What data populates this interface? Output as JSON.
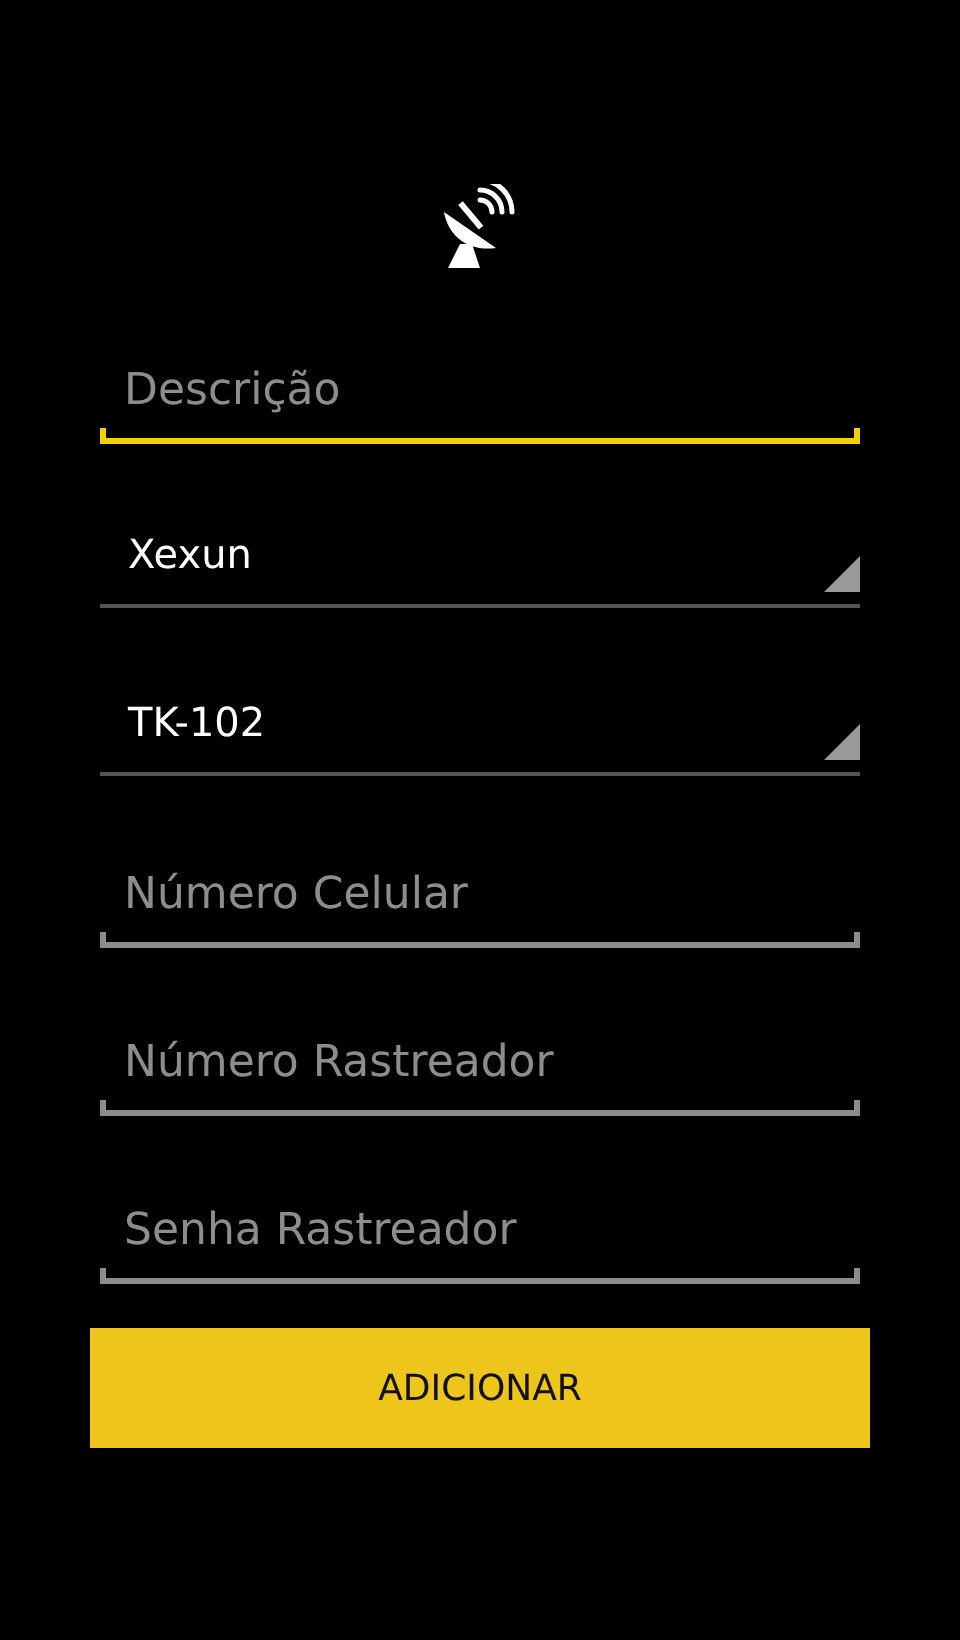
{
  "fields": [
    {
      "kind": "text",
      "placeholder": "Descrição",
      "focused": true
    },
    {
      "kind": "spinner",
      "value": "Xexun"
    },
    {
      "kind": "spinner",
      "value": "TK-102"
    },
    {
      "kind": "text",
      "placeholder": "Número Celular",
      "focused": false
    },
    {
      "kind": "text",
      "placeholder": "Número Rastreador",
      "focused": false
    },
    {
      "kind": "text",
      "placeholder": "Senha Rastreador",
      "focused": false
    }
  ],
  "button": {
    "label": "ADICIONAR"
  }
}
